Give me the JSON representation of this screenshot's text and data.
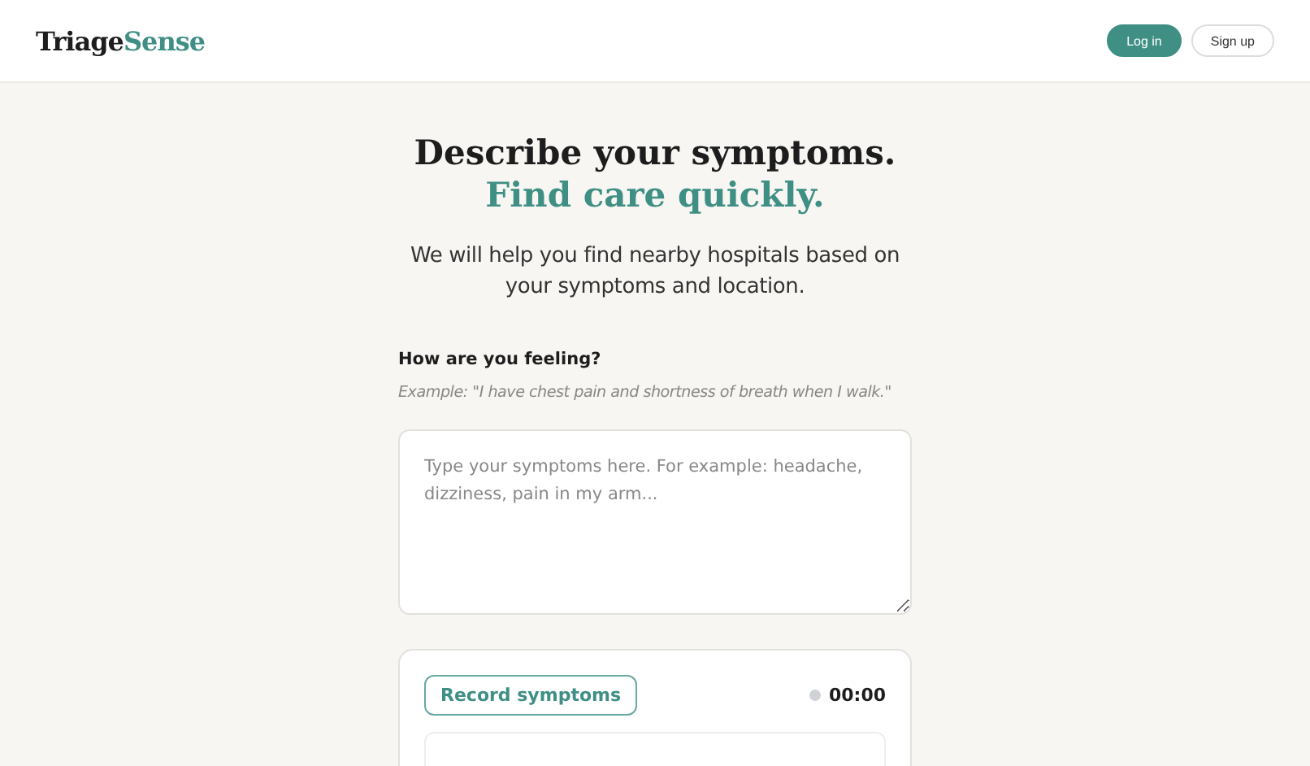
{
  "header": {
    "logo": {
      "first": "Triage",
      "second": "Sense"
    },
    "buttons": [
      {
        "label": "Log in",
        "kind": "primary"
      },
      {
        "label": "Sign up",
        "kind": "secondary"
      }
    ]
  },
  "hero": {
    "title": "Describe your symptoms.",
    "subtitle": "Find care quickly.",
    "description": "We will help you find nearby hospitals based on your symptoms and location."
  },
  "form": {
    "label": "How are you feeling?",
    "example": "Example: \"I have chest pain and shortness of breath when I walk.\"",
    "placeholder": "Type your symptoms here. For example: headache, dizziness, pain in my arm..."
  },
  "recorder": {
    "button": "Record symptoms",
    "recording": false,
    "timer": "00:00"
  }
}
